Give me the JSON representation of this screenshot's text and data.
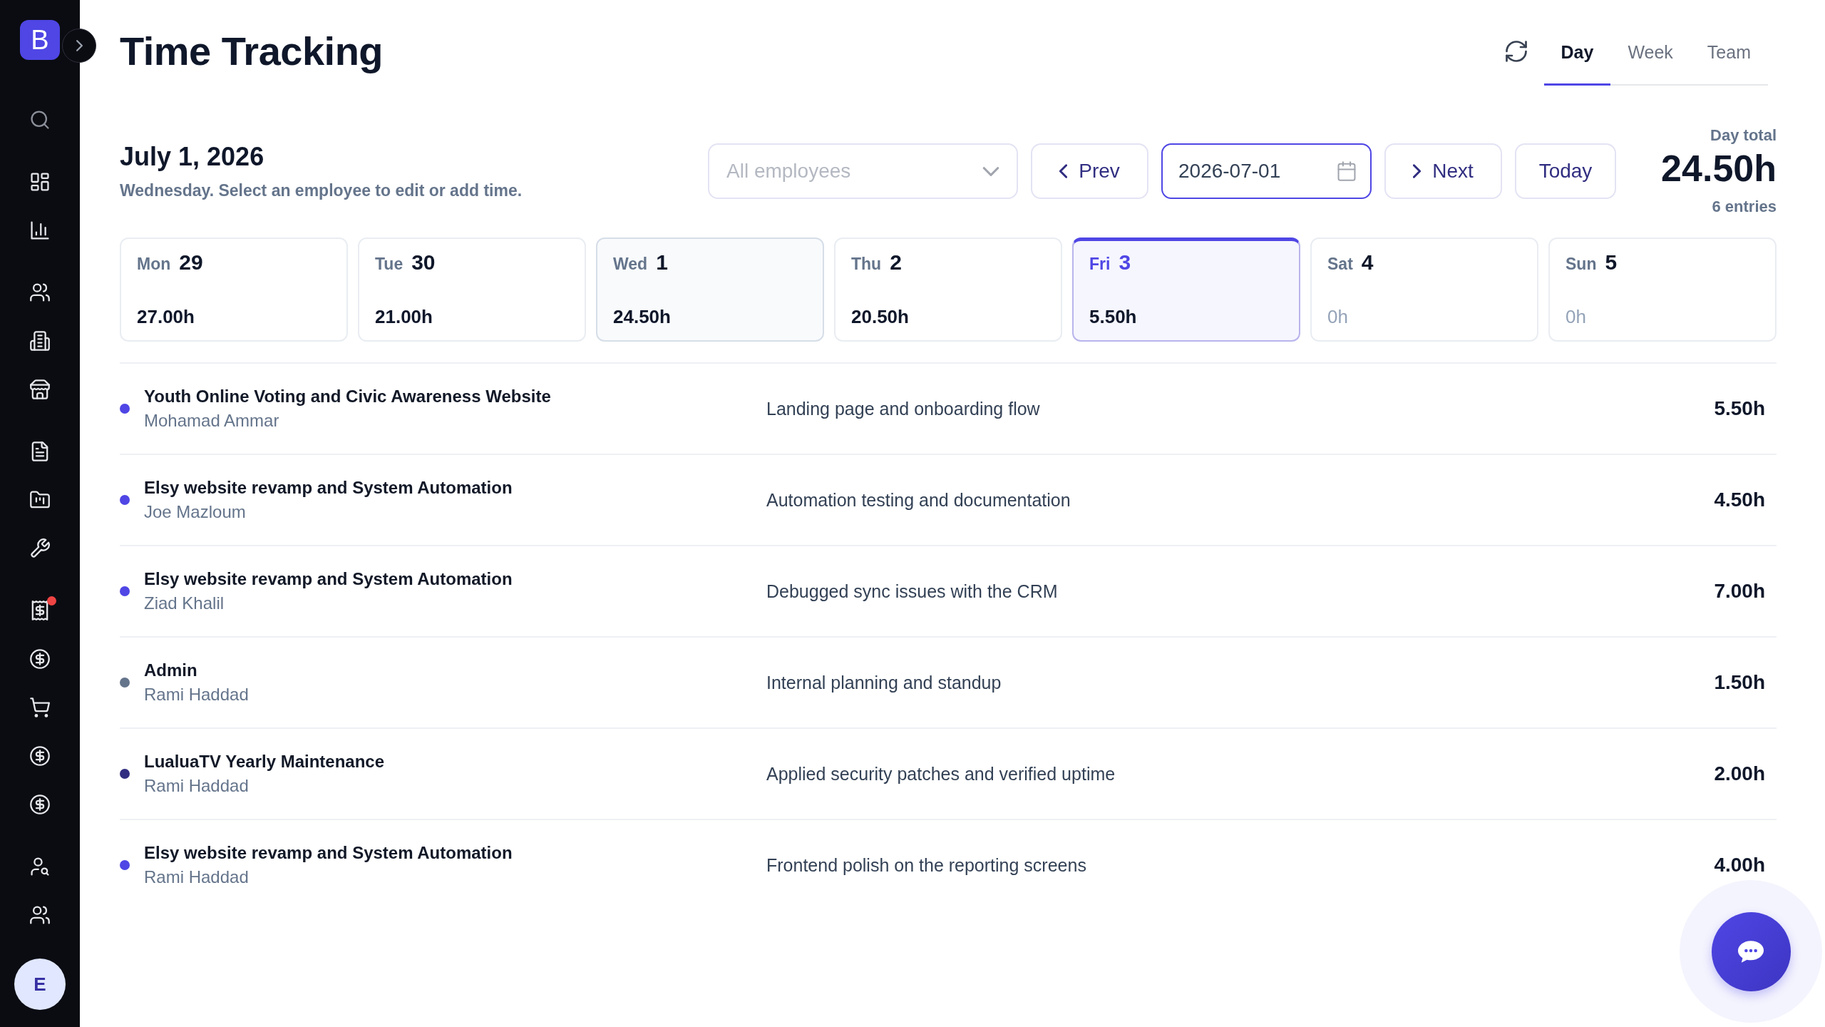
{
  "sidebar": {
    "logo": "B",
    "groups": [
      {
        "items": [
          {
            "badge": false
          }
        ]
      },
      {
        "items": [
          {
            "badge": false
          },
          {
            "badge": false
          }
        ]
      },
      {
        "items": [
          {
            "badge": false
          },
          {
            "badge": false
          },
          {
            "badge": false
          }
        ]
      },
      {
        "items": [
          {
            "badge": false
          },
          {
            "badge": false
          },
          {
            "badge": false
          }
        ]
      },
      {
        "items": [
          {
            "badge": true
          },
          {
            "badge": false
          },
          {
            "badge": false
          },
          {
            "badge": false
          },
          {
            "badge": false
          }
        ]
      },
      {
        "items": [
          {
            "badge": false
          },
          {
            "badge": false
          }
        ]
      }
    ],
    "avatar": "E"
  },
  "header": {
    "title": "Time Tracking",
    "tabs": [
      {
        "label": "Day",
        "selected": true
      },
      {
        "label": "Week",
        "selected": false
      },
      {
        "label": "Team",
        "selected": false
      }
    ]
  },
  "day_bar": {
    "date": "July 1, 2026",
    "subtitle": "Wednesday. Select an employee to edit or add time.",
    "employee_filter": {
      "placeholder": "All employees"
    },
    "prev_button": "Prev",
    "date_field": {
      "value": "2026-07-01",
      "focused": true
    },
    "next_button": "Next",
    "today_button": "Today",
    "day_total": {
      "label": "Day total",
      "value": "24.50h",
      "entries": "6 entries"
    }
  },
  "week": [
    {
      "day": "Mon",
      "date": "29",
      "hours": "27.00h",
      "selected": false,
      "today": false,
      "empty": false
    },
    {
      "day": "Tue",
      "date": "30",
      "hours": "21.00h",
      "selected": false,
      "today": false,
      "empty": false
    },
    {
      "day": "Wed",
      "date": "1",
      "hours": "24.50h",
      "selected": true,
      "today": false,
      "empty": false
    },
    {
      "day": "Thu",
      "date": "2",
      "hours": "20.50h",
      "selected": false,
      "today": false,
      "empty": false
    },
    {
      "day": "Fri",
      "date": "3",
      "hours": "5.50h",
      "selected": false,
      "today": true,
      "empty": false
    },
    {
      "day": "Sat",
      "date": "4",
      "hours": "0h",
      "selected": false,
      "today": false,
      "empty": true
    },
    {
      "day": "Sun",
      "date": "5",
      "hours": "0h",
      "selected": false,
      "today": false,
      "empty": true
    }
  ],
  "entries": [
    {
      "project": "Youth Online Voting and Civic Awareness Website",
      "employee": "Mohamad Ammar",
      "note": "Landing page and onboarding flow",
      "hours": "5.50h",
      "color": "#4f46e5"
    },
    {
      "project": "Elsy website revamp and System Automation",
      "employee": "Joe Mazloum",
      "note": "Automation testing and documentation",
      "hours": "4.50h",
      "color": "#4f46e5"
    },
    {
      "project": "Elsy website revamp and System Automation",
      "employee": "Ziad Khalil",
      "note": "Debugged sync issues with the CRM",
      "hours": "7.00h",
      "color": "#4f46e5"
    },
    {
      "project": "Admin",
      "employee": "Rami Haddad",
      "note": "Internal planning and standup",
      "hours": "1.50h",
      "color": "#64748b"
    },
    {
      "project": "LualuaTV Yearly Maintenance",
      "employee": "Rami Haddad",
      "note": "Applied security patches and verified uptime",
      "hours": "2.00h",
      "color": "#312e81"
    },
    {
      "project": "Elsy website revamp and System Automation",
      "employee": "Rami Haddad",
      "note": "Frontend polish on the reporting screens",
      "hours": "4.00h",
      "color": "#4f46e5"
    }
  ]
}
